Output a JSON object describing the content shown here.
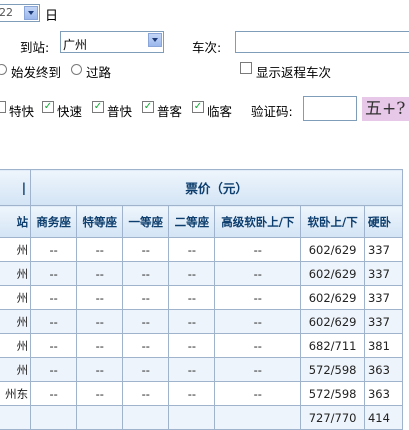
{
  "form": {
    "date_select_value": "22",
    "day_suffix": "日",
    "to_station_label": "到站:",
    "to_station_value": "广州",
    "train_no_label": "车次:",
    "origin_radio_label": "始发终到",
    "passing_radio_label": "过路",
    "show_return_label": "显示返程车次",
    "train_types": [
      {
        "label": "特快",
        "checked": false
      },
      {
        "label": "快速",
        "checked": true
      },
      {
        "label": "普快",
        "checked": true
      },
      {
        "label": "普客",
        "checked": true
      },
      {
        "label": "临客",
        "checked": true
      }
    ],
    "captcha_label": "验证码:",
    "captcha_image_text": "五+?"
  },
  "table": {
    "first_col_header": "站",
    "price_header": "票价（元）",
    "columns": [
      "商务座",
      "特等座",
      "一等座",
      "二等座",
      "高级软卧上/下",
      "软卧上/下",
      "硬卧"
    ],
    "rows": [
      {
        "station": "州",
        "cells": [
          "--",
          "--",
          "--",
          "--",
          "--",
          "602/629",
          "337"
        ]
      },
      {
        "station": "州",
        "cells": [
          "--",
          "--",
          "--",
          "--",
          "--",
          "602/629",
          "337"
        ]
      },
      {
        "station": "州",
        "cells": [
          "--",
          "--",
          "--",
          "--",
          "--",
          "602/629",
          "337"
        ]
      },
      {
        "station": "州",
        "cells": [
          "--",
          "--",
          "--",
          "--",
          "--",
          "602/629",
          "337"
        ]
      },
      {
        "station": "州",
        "cells": [
          "--",
          "--",
          "--",
          "--",
          "--",
          "682/711",
          "381"
        ]
      },
      {
        "station": "州",
        "cells": [
          "--",
          "--",
          "--",
          "--",
          "--",
          "572/598",
          "363"
        ]
      },
      {
        "station": "州东",
        "cells": [
          "--",
          "--",
          "--",
          "--",
          "--",
          "572/598",
          "363"
        ]
      },
      {
        "station": "",
        "cells": [
          "",
          "",
          "",
          "",
          "",
          "727/770",
          "414"
        ]
      }
    ]
  }
}
